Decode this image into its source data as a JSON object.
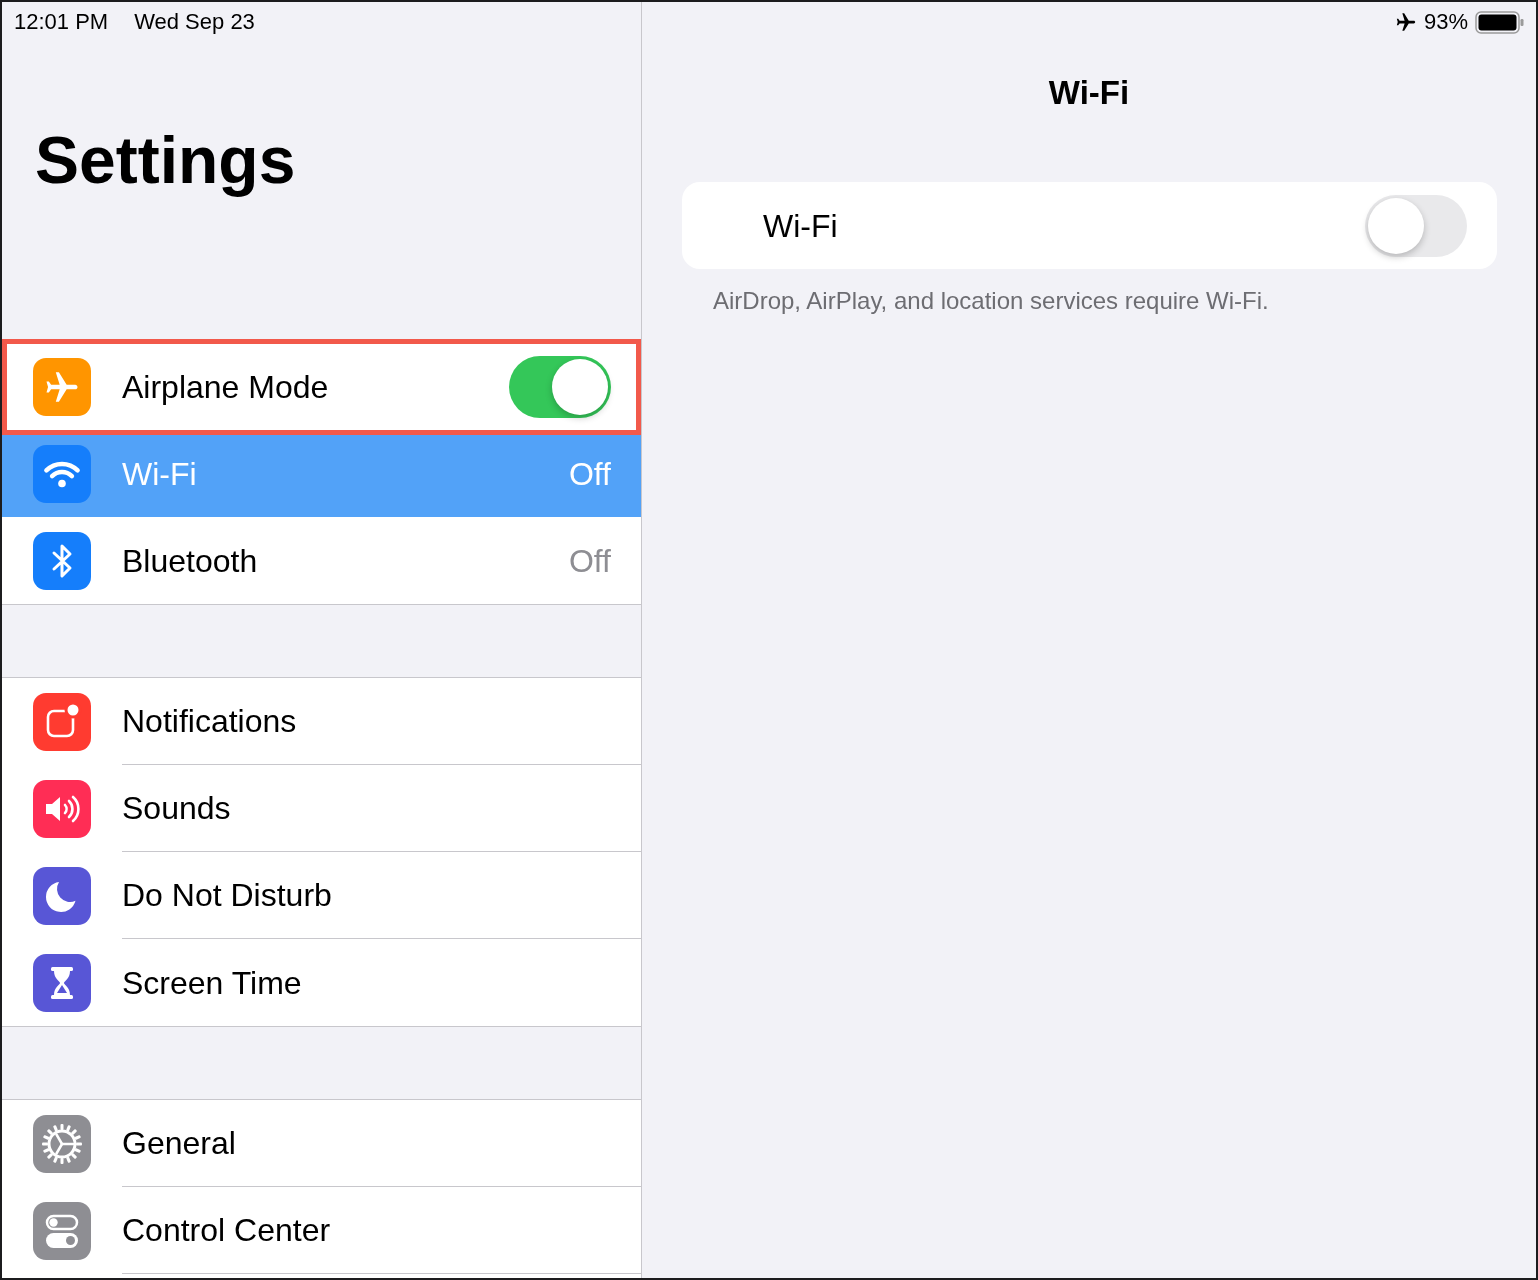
{
  "status_bar": {
    "time": "12:01 PM",
    "date": "Wed Sep 23",
    "battery": "93%"
  },
  "sidebar": {
    "title": "Settings",
    "groups": [
      {
        "items": [
          {
            "kind": "toggle",
            "label": "Airplane Mode",
            "on": true,
            "selected": false,
            "highlighted": true
          },
          {
            "kind": "value",
            "label": "Wi-Fi",
            "value": "Off",
            "selected": true,
            "highlighted": false
          },
          {
            "kind": "value",
            "label": "Bluetooth",
            "value": "Off",
            "selected": false,
            "highlighted": false
          }
        ]
      },
      {
        "items": [
          {
            "kind": "link",
            "label": "Notifications",
            "selected": false,
            "highlighted": false
          },
          {
            "kind": "link",
            "label": "Sounds",
            "selected": false,
            "highlighted": false
          },
          {
            "kind": "link",
            "label": "Do Not Disturb",
            "selected": false,
            "highlighted": false
          },
          {
            "kind": "link",
            "label": "Screen Time",
            "selected": false,
            "highlighted": false
          }
        ]
      },
      {
        "items": [
          {
            "kind": "link",
            "label": "General",
            "selected": false,
            "highlighted": false
          },
          {
            "kind": "link",
            "label": "Control Center",
            "selected": false,
            "highlighted": false
          }
        ]
      }
    ]
  },
  "detail": {
    "title": "Wi-Fi",
    "toggle": {
      "label": "Wi-Fi",
      "on": false
    },
    "footer": "AirDrop, AirPlay, and location services require Wi-Fi."
  }
}
